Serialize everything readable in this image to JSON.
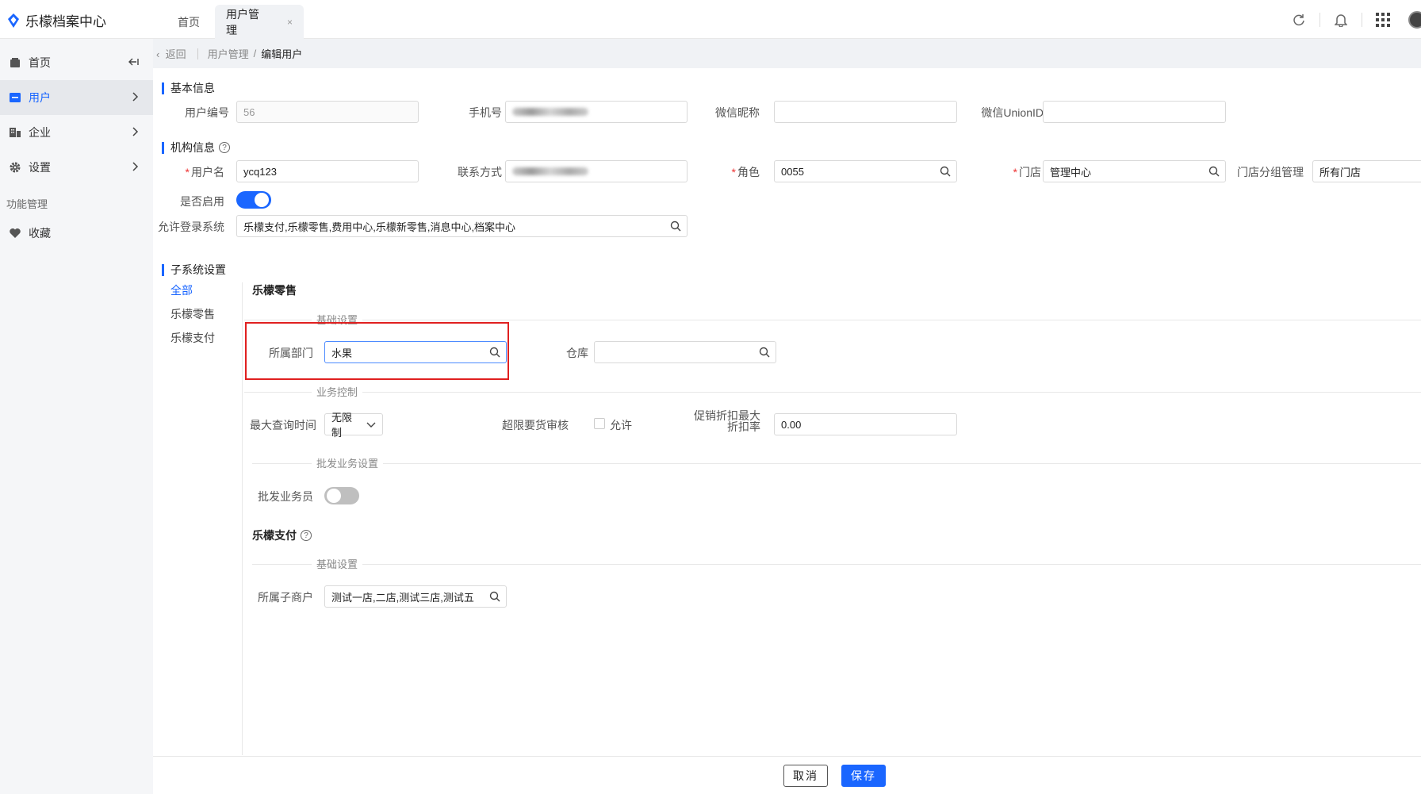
{
  "app": {
    "title": "乐檬档案中心"
  },
  "tabs": [
    {
      "label": "首页"
    },
    {
      "label": "用户管理",
      "close": "×"
    }
  ],
  "sidebar": {
    "items": [
      {
        "label": "首页",
        "icon": "home-icon"
      },
      {
        "label": "用户",
        "icon": "user-card-icon",
        "active": true
      },
      {
        "label": "企业",
        "icon": "building-icon"
      },
      {
        "label": "设置",
        "icon": "gear-icon"
      }
    ],
    "group_label": "功能管理",
    "favorites_label": "收藏"
  },
  "breadcrumb": {
    "back": "返回",
    "parent": "用户管理",
    "current": "编辑用户",
    "separator": "/"
  },
  "basic_info": {
    "title": "基本信息",
    "user_id_label": "用户编号",
    "user_id_value": "56",
    "phone_label": "手机号",
    "wechat_nick_label": "微信昵称",
    "wechat_nick_value": "",
    "unionid_label": "微信UnionID",
    "unionid_value": ""
  },
  "org_info": {
    "title": "机构信息",
    "username_label": "用户名",
    "username_value": "ycq123",
    "contact_label": "联系方式",
    "role_label": "角色",
    "role_value": "0055",
    "store_label": "门店",
    "store_value": "管理中心",
    "store_group_label": "门店分组管理",
    "store_group_value": "所有门店",
    "enabled_label": "是否启用",
    "systems_label": "允许登录系统",
    "systems_value": "乐檬支付,乐檬零售,费用中心,乐檬新零售,消息中心,档案中心"
  },
  "subsystem": {
    "title": "子系统设置",
    "nav": [
      "全部",
      "乐檬零售",
      "乐檬支付"
    ],
    "retail": {
      "title": "乐檬零售",
      "basic_label": "基础设置",
      "dept_label": "所属部门",
      "dept_value": "水果",
      "warehouse_label": "仓库",
      "warehouse_value": "",
      "biz_control_label": "业务控制",
      "max_query_label": "最大查询时间",
      "max_query_value": "无限制",
      "over_limit_label": "超限要货审核",
      "over_limit_option": "允许",
      "promo_label_1": "促销折扣最大",
      "promo_label_2": "折扣率",
      "promo_value": "0.00",
      "wholesale_label": "批发业务设置",
      "wholesale_staff_label": "批发业务员"
    },
    "pay": {
      "title": "乐檬支付",
      "basic_label": "基础设置",
      "merchant_label": "所属子商户",
      "merchant_value": "测试一店,二店,测试三店,测试五"
    }
  },
  "footer": {
    "cancel": "取消",
    "save": "保存"
  },
  "colors": {
    "accent": "#1a66ff",
    "highlight": "#e02020"
  }
}
